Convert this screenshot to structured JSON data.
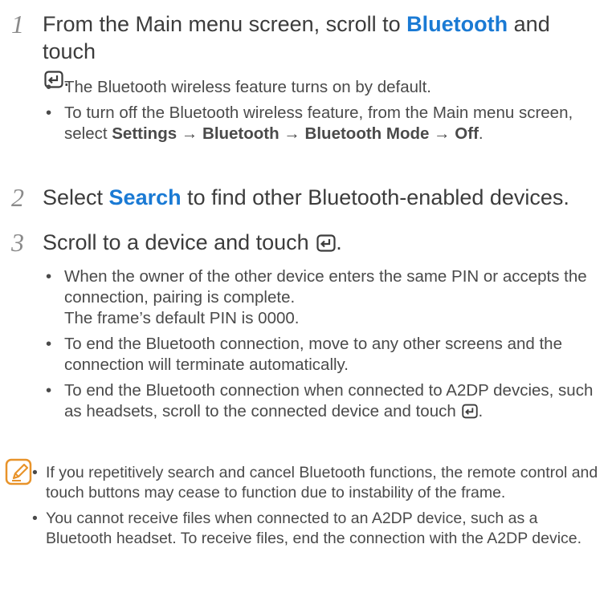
{
  "steps": [
    {
      "number": "1",
      "text_parts": [
        "From the Main menu screen, scroll to ",
        "Bluetooth",
        " and touch"
      ],
      "text_end": ".",
      "icon": "enter-key-icon",
      "bullets": [
        {
          "text": "The Bluetooth wireless feature turns on by default."
        },
        {
          "text_parts": [
            "To turn off the Bluetooth wireless feature, from the Main menu screen, select ",
            "Settings → Bluetooth → Bluetooth Mode → Off",
            "."
          ]
        }
      ]
    },
    {
      "number": "2",
      "text_parts": [
        "Select ",
        "Search",
        " to find other Bluetooth-enabled devices."
      ]
    },
    {
      "number": "3",
      "text_parts": [
        "Scroll to a device and touch"
      ],
      "text_end": ".",
      "icon": "enter-key-icon",
      "bullets": [
        {
          "text": "When the owner of the other device enters the same PIN or accepts the connection, pairing is complete.",
          "text2": "The frame’s default PIN is 0000."
        },
        {
          "text": "To end the Bluetooth connection, move to any other screens and the connection will terminate automatically."
        },
        {
          "text": "To end the Bluetooth connection when connected to A2DP devcies, such as headsets, scroll to the connected device and touch",
          "text_end": "."
        }
      ]
    }
  ],
  "note": {
    "icon": "note-pencil-icon",
    "accent_color": "#e8932a",
    "items": [
      "If you repetitively search and cancel Bluetooth functions, the remote control and touch buttons may cease to function due to instability of the frame.",
      "You cannot receive files when connected to  an A2DP device, such as a Bluetooth headset. To receive files, end the connection with the A2DP device."
    ]
  },
  "colors": {
    "highlight": "#1a7ad4",
    "text": "#3c3c3c",
    "step_number": "#8a8a8a"
  }
}
